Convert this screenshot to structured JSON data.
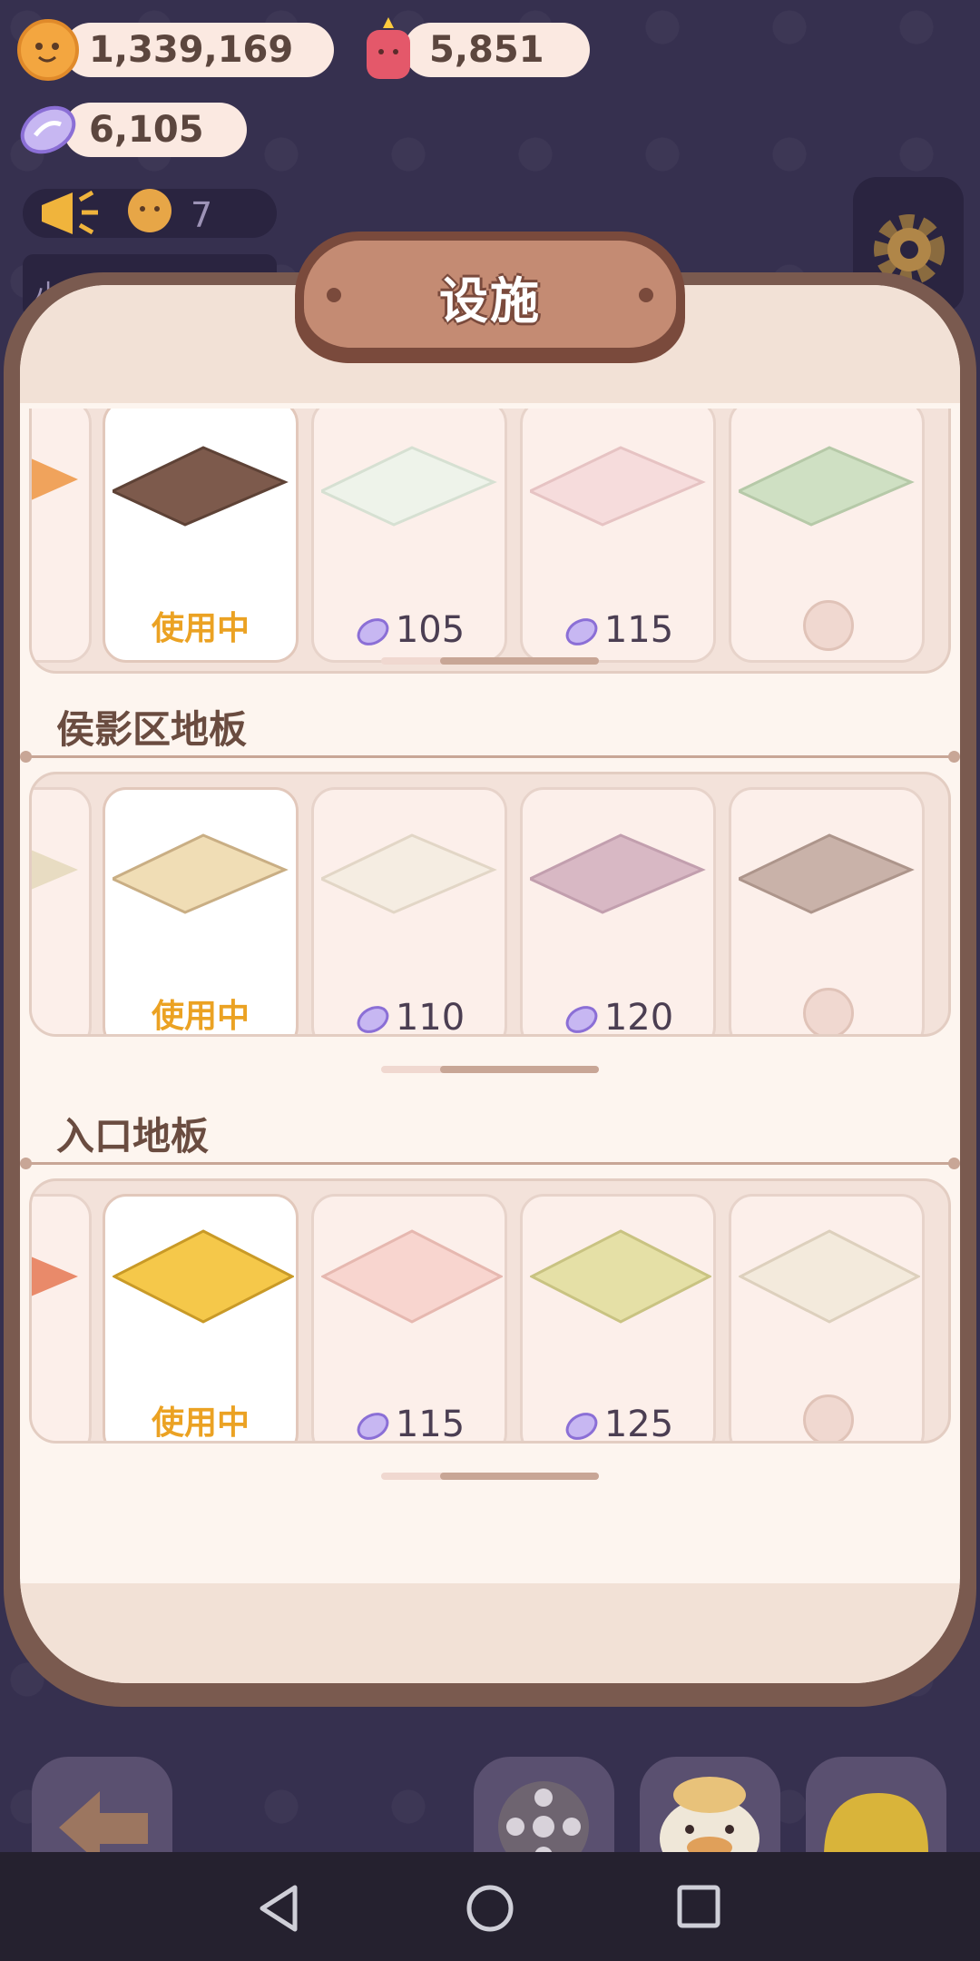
{
  "currencies": {
    "coins": "1,339,169",
    "candles": "5,851",
    "gems": "6,105"
  },
  "notice": {
    "count": "7",
    "partial_label": "小精灵"
  },
  "panel": {
    "title": "设施"
  },
  "sections": [
    {
      "title": "",
      "items": [
        {
          "state": "使用中",
          "color": "#7d5a4c"
        },
        {
          "price": "105",
          "color": "#eef3ea"
        },
        {
          "price": "115",
          "color": "#f6dcdc"
        },
        {
          "locked": true,
          "color": "#cfe0c3"
        }
      ]
    },
    {
      "title": "侯影区地板",
      "items": [
        {
          "state": "使用中",
          "color": "#f0ddb5"
        },
        {
          "price": "110",
          "color": "#f5ede2"
        },
        {
          "price": "120",
          "color": "#d8b8c4"
        },
        {
          "locked": true,
          "color": "#c9b2a9"
        }
      ]
    },
    {
      "title": "入口地板",
      "items": [
        {
          "state": "使用中",
          "color": "#f5c84a"
        },
        {
          "price": "115",
          "color": "#f8d5cf"
        },
        {
          "price": "125",
          "color": "#e5e0a6"
        },
        {
          "locked": true,
          "color": "#f3eadc"
        }
      ]
    }
  ],
  "bottom_buttons": [
    "back-arrow-icon",
    "film-reel-icon",
    "duck-chef-icon",
    "hard-hat-icon"
  ],
  "colors": {
    "accent": "#eba223",
    "panel_border": "#7a5a4f",
    "background": "#36304f"
  }
}
